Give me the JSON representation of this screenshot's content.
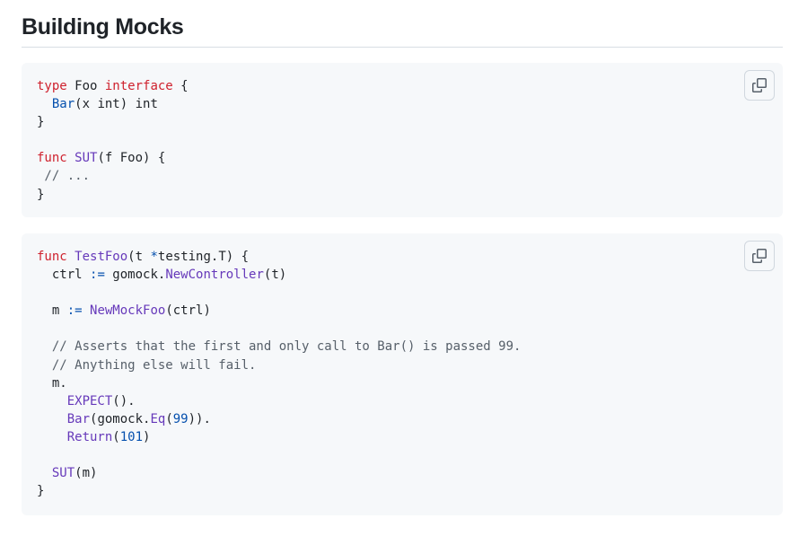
{
  "page": {
    "title": "Building Mocks"
  },
  "code_blocks": [
    {
      "lines": [
        [
          {
            "t": "type",
            "c": "kw"
          },
          {
            "t": " Foo "
          },
          {
            "t": "interface",
            "c": "kw"
          },
          {
            "t": " {"
          }
        ],
        [
          {
            "t": "  "
          },
          {
            "t": "Bar",
            "c": "nm"
          },
          {
            "t": "(x int) int"
          }
        ],
        [
          {
            "t": "}"
          }
        ],
        [
          {
            "t": ""
          }
        ],
        [
          {
            "t": "func",
            "c": "kw"
          },
          {
            "t": " "
          },
          {
            "t": "SUT",
            "c": "fn"
          },
          {
            "t": "(f Foo) {"
          }
        ],
        [
          {
            "t": " // ...",
            "c": "cm"
          }
        ],
        [
          {
            "t": "}"
          }
        ]
      ],
      "copy_icon": "copy-icon"
    },
    {
      "lines": [
        [
          {
            "t": "func",
            "c": "kw"
          },
          {
            "t": " "
          },
          {
            "t": "TestFoo",
            "c": "fn"
          },
          {
            "t": "(t "
          },
          {
            "t": "*",
            "c": "op"
          },
          {
            "t": "testing.T) {"
          }
        ],
        [
          {
            "t": "  ctrl "
          },
          {
            "t": ":=",
            "c": "op"
          },
          {
            "t": " gomock."
          },
          {
            "t": "NewController",
            "c": "fn"
          },
          {
            "t": "(t)"
          }
        ],
        [
          {
            "t": ""
          }
        ],
        [
          {
            "t": "  m "
          },
          {
            "t": ":=",
            "c": "op"
          },
          {
            "t": " "
          },
          {
            "t": "NewMockFoo",
            "c": "fn"
          },
          {
            "t": "(ctrl)"
          }
        ],
        [
          {
            "t": ""
          }
        ],
        [
          {
            "t": "  // Asserts that the first and only call to Bar() is passed 99.",
            "c": "cm"
          }
        ],
        [
          {
            "t": "  // Anything else will fail.",
            "c": "cm"
          }
        ],
        [
          {
            "t": "  m."
          }
        ],
        [
          {
            "t": "    "
          },
          {
            "t": "EXPECT",
            "c": "fn"
          },
          {
            "t": "()."
          }
        ],
        [
          {
            "t": "    "
          },
          {
            "t": "Bar",
            "c": "fn"
          },
          {
            "t": "(gomock."
          },
          {
            "t": "Eq",
            "c": "fn"
          },
          {
            "t": "("
          },
          {
            "t": "99",
            "c": "nm"
          },
          {
            "t": "))."
          }
        ],
        [
          {
            "t": "    "
          },
          {
            "t": "Return",
            "c": "fn"
          },
          {
            "t": "("
          },
          {
            "t": "101",
            "c": "nm"
          },
          {
            "t": ")"
          }
        ],
        [
          {
            "t": ""
          }
        ],
        [
          {
            "t": "  "
          },
          {
            "t": "SUT",
            "c": "fn"
          },
          {
            "t": "(m)"
          }
        ],
        [
          {
            "t": "}"
          }
        ]
      ],
      "copy_icon": "copy-icon"
    }
  ],
  "colors": {
    "keyword": "#cf222e",
    "function": "#6639ba",
    "number": "#0550ae",
    "comment": "#57606a",
    "code_background": "#f6f8fa"
  }
}
